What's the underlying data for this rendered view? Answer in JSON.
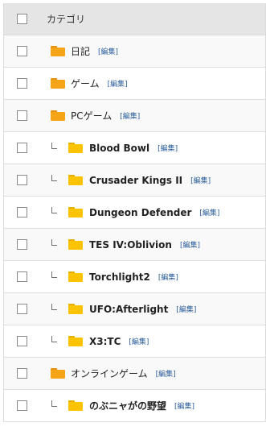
{
  "header": {
    "label": "カテゴリ"
  },
  "edit_label": "[編集]",
  "rows": [
    {
      "name": "日記",
      "level": 0
    },
    {
      "name": "ゲーム",
      "level": 0
    },
    {
      "name": "PCゲーム",
      "level": 0
    },
    {
      "name": "Blood Bowl",
      "level": 1
    },
    {
      "name": "Crusader Kings II",
      "level": 1
    },
    {
      "name": "Dungeon Defender",
      "level": 1
    },
    {
      "name": "TES IV:Oblivion",
      "level": 1
    },
    {
      "name": "Torchlight2",
      "level": 1
    },
    {
      "name": "UFO:Afterlight",
      "level": 1
    },
    {
      "name": "X3:TC",
      "level": 1
    },
    {
      "name": "オンラインゲーム",
      "level": 0
    },
    {
      "name": "のぶニャがの野望",
      "level": 1
    }
  ],
  "colors": {
    "header_bg": "#e5e5e5",
    "folder_parent": "#f6a417",
    "folder_child": "#fcc300",
    "edit_link": "#2b5d9b"
  }
}
